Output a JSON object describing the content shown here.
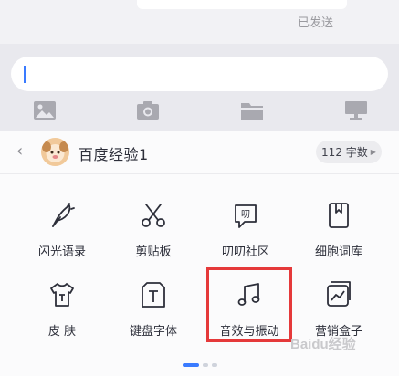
{
  "chat": {
    "sent_status": "已发送"
  },
  "toolbar": {
    "icons": [
      "image-icon",
      "camera-icon",
      "folder-icon",
      "screen-icon"
    ]
  },
  "keyboard_bar": {
    "brand_name": "百度经验1",
    "count_label": "112 字数"
  },
  "panel": {
    "items": [
      {
        "label": "闪光语录",
        "icon": "feather-pen-icon"
      },
      {
        "label": "剪贴板",
        "icon": "scissors-icon"
      },
      {
        "label": "叨叨社区",
        "icon": "chat-bubble-icon"
      },
      {
        "label": "细胞词库",
        "icon": "bookmark-book-icon"
      },
      {
        "label": "皮 肤",
        "icon": "tshirt-icon"
      },
      {
        "label": "键盘字体",
        "icon": "font-t-icon"
      },
      {
        "label": "音效与振动",
        "icon": "music-note-icon"
      },
      {
        "label": "营销盒子",
        "icon": "chart-box-icon"
      }
    ]
  },
  "watermark": "Baidu经验",
  "accent_color": "#3a7bff",
  "highlight_color": "#e5393a"
}
